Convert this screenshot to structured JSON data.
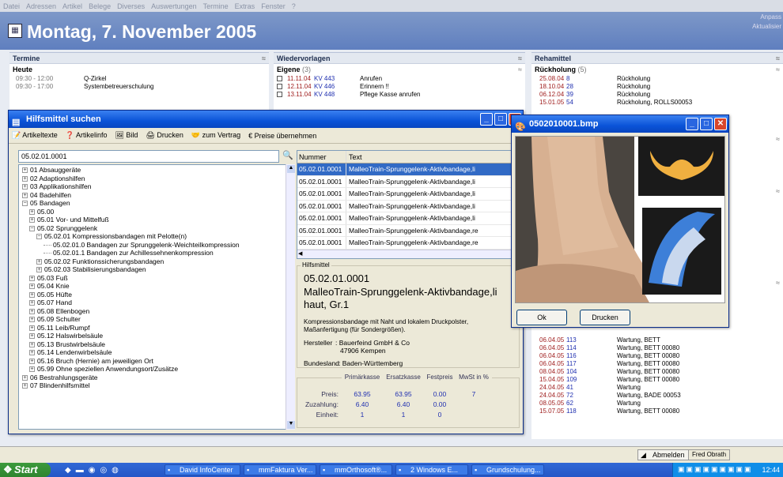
{
  "menu": [
    "Datei",
    "Adressen",
    "Artikel",
    "Belege",
    "Diverses",
    "Auswertungen",
    "Termine",
    "Extras",
    "Fenster",
    "?"
  ],
  "header": {
    "title": "Montag, 7. November 2005",
    "right1": "Anpass",
    "right2": "Aktualisier"
  },
  "termine": {
    "title": "Termine",
    "sub": "Heute",
    "rows": [
      {
        "time": "09:30 - 12:00",
        "text": "Q-Zirkel"
      },
      {
        "time": "09:30 - 17:00",
        "text": "Systembetreuerschulung"
      }
    ]
  },
  "wiedervorlagen": {
    "title": "Wiedervorlagen",
    "sub": "Eigene",
    "count": "(3)",
    "rows": [
      {
        "date": "11.11.04",
        "kv": "KV 443",
        "text": "Anrufen"
      },
      {
        "date": "12.11.04",
        "kv": "KV 446",
        "text": "Erinnern !!"
      },
      {
        "date": "13.11.04",
        "kv": "KV 448",
        "text": "Pflege Kasse anrufen"
      }
    ]
  },
  "rehamittel": {
    "title": "Rehamittel",
    "sub": "Rückholung",
    "count": "(5)",
    "top_rows": [
      {
        "date": "25.08.04",
        "nr": "8",
        "text": "Rückholung"
      },
      {
        "date": "18.10.04",
        "nr": "28",
        "text": "Rückholung"
      },
      {
        "date": "06.12.04",
        "nr": "39",
        "text": "Rückholung"
      },
      {
        "date": "15.01.05",
        "nr": "54",
        "text": "Rückholung, ROLLS00053"
      }
    ],
    "rows": [
      {
        "date": "06.04.05",
        "nr": "113",
        "text": "Wartung, BETT"
      },
      {
        "date": "06.04.05",
        "nr": "114",
        "text": "Wartung, BETT 00080"
      },
      {
        "date": "06.04.05",
        "nr": "116",
        "text": "Wartung, BETT 00080"
      },
      {
        "date": "06.04.05",
        "nr": "117",
        "text": "Wartung, BETT 00080"
      },
      {
        "date": "08.04.05",
        "nr": "104",
        "text": "Wartung, BETT 00080"
      },
      {
        "date": "15.04.05",
        "nr": "109",
        "text": "Wartung, BETT 00080"
      },
      {
        "date": "24.04.05",
        "nr": "41",
        "text": "Wartung"
      },
      {
        "date": "24.04.05",
        "nr": "72",
        "text": "Wartung, BADE 00053"
      },
      {
        "date": "08.05.05",
        "nr": "62",
        "text": "Wartung"
      },
      {
        "date": "15.07.05",
        "nr": "118",
        "text": "Wartung, BETT 00080"
      }
    ]
  },
  "hilfsmittel": {
    "title": "Hilfsmittel suchen",
    "toolbar": [
      "Artikeltexte",
      "Artikelinfo",
      "Bild",
      "Drucken",
      "zum Vertrag",
      "Preise übernehmen"
    ],
    "search_value": "05.02.01.0001",
    "tree": [
      {
        "indent": 0,
        "pm": "+",
        "text": "01  Absauggeräte"
      },
      {
        "indent": 0,
        "pm": "+",
        "text": "02  Adaptionshilfen"
      },
      {
        "indent": 0,
        "pm": "+",
        "text": "03  Applikationshilfen"
      },
      {
        "indent": 0,
        "pm": "+",
        "text": "04  Badehilfen"
      },
      {
        "indent": 0,
        "pm": "−",
        "text": "05  Bandagen"
      },
      {
        "indent": 1,
        "pm": "+",
        "text": "05.00"
      },
      {
        "indent": 1,
        "pm": "+",
        "text": "05.01   Vor- und Mittelfuß"
      },
      {
        "indent": 1,
        "pm": "−",
        "text": "05.02   Sprunggelenk"
      },
      {
        "indent": 2,
        "pm": "−",
        "text": "05.02.01   Kompressionsbandagen mit Pelotte(n)"
      },
      {
        "indent": 3,
        "pm": "",
        "text": "05.02.01.0   Bandagen zur Sprunggelenk-Weichteilkompression"
      },
      {
        "indent": 3,
        "pm": "",
        "text": "05.02.01.1   Bandagen zur Achillessehnenkompression"
      },
      {
        "indent": 2,
        "pm": "+",
        "text": "05.02.02   Funktionssicherungsbandagen"
      },
      {
        "indent": 2,
        "pm": "+",
        "text": "05.02.03   Stabilisierungsbandagen"
      },
      {
        "indent": 1,
        "pm": "+",
        "text": "05.03   Fuß"
      },
      {
        "indent": 1,
        "pm": "+",
        "text": "05.04   Knie"
      },
      {
        "indent": 1,
        "pm": "+",
        "text": "05.05   Hüfte"
      },
      {
        "indent": 1,
        "pm": "+",
        "text": "05.07   Hand"
      },
      {
        "indent": 1,
        "pm": "+",
        "text": "05.08   Ellenbogen"
      },
      {
        "indent": 1,
        "pm": "+",
        "text": "05.09   Schulter"
      },
      {
        "indent": 1,
        "pm": "+",
        "text": "05.11   Leib/Rumpf"
      },
      {
        "indent": 1,
        "pm": "+",
        "text": "05.12   Halswirbelsäule"
      },
      {
        "indent": 1,
        "pm": "+",
        "text": "05.13   Brustwirbelsäule"
      },
      {
        "indent": 1,
        "pm": "+",
        "text": "05.14   Lendenwirbelsäule"
      },
      {
        "indent": 1,
        "pm": "+",
        "text": "05.16   Bruch (Hernie) am jeweiligen Ort"
      },
      {
        "indent": 1,
        "pm": "+",
        "text": "05.99   Ohne speziellen Anwendungsort/Zusätze"
      },
      {
        "indent": 0,
        "pm": "+",
        "text": "06  Bestrahlungsgeräte"
      },
      {
        "indent": 0,
        "pm": "+",
        "text": "07  Blindenhilfsmittel"
      }
    ],
    "grid_headers": [
      "Nummer",
      "Text"
    ],
    "grid_rows": [
      {
        "nr": "05.02.01.0001",
        "text": "MalleoTrain-Sprunggelenk-Aktivbandage,li",
        "sel": true
      },
      {
        "nr": "05.02.01.0001",
        "text": "MalleoTrain-Sprunggelenk-Aktivbandage,li"
      },
      {
        "nr": "05.02.01.0001",
        "text": "MalleoTrain-Sprunggelenk-Aktivbandage,li"
      },
      {
        "nr": "05.02.01.0001",
        "text": "MalleoTrain-Sprunggelenk-Aktivbandage,li"
      },
      {
        "nr": "05.02.01.0001",
        "text": "MalleoTrain-Sprunggelenk-Aktivbandage,li"
      },
      {
        "nr": "05.02.01.0001",
        "text": "MalleoTrain-Sprunggelenk-Aktivbandage,re"
      },
      {
        "nr": "05.02.01.0001",
        "text": "MalleoTrain-Sprunggelenk-Aktivbandage,re"
      },
      {
        "nr": "05.02.01.0001",
        "text": "MalleoTrain-Sprunggelenk-Aktivbandage,re"
      }
    ],
    "detail": {
      "group_label": "Hilfsmittel",
      "number": "05.02.01.0001",
      "name": "MalleoTrain-Sprunggelenk-Aktivbandage,li haut, Gr.1",
      "desc": "Kompressionsbandage mit Naht und lokalem Druckpolster, Maßanfertigung (für Sondergrößen).",
      "hersteller_label": "Hersteller",
      "hersteller1": ": Bauerfeind GmbH & Co",
      "hersteller2": "47906 Kempen",
      "bundesland_label": "Bundesland",
      "bundesland": ": Baden-Württemberg"
    },
    "prices": {
      "headers": [
        "Primärkasse",
        "Ersatzkasse",
        "Festpreis",
        "MwSt in %"
      ],
      "rows": [
        {
          "label": "Preis:",
          "values": [
            "63.95",
            "63.95",
            "0.00",
            "7"
          ]
        },
        {
          "label": "Zuzahlung:",
          "values": [
            "6.40",
            "6.40",
            "0.00",
            ""
          ]
        },
        {
          "label": "Einheit:",
          "values": [
            "1",
            "1",
            "0",
            ""
          ]
        }
      ]
    }
  },
  "image_window": {
    "title": "0502010001.bmp",
    "ok": "Ok",
    "print": "Drucken"
  },
  "statusbar": {
    "abmelden": "Abmelden",
    "user": "Fred Obrath"
  },
  "taskbar": {
    "start": "Start",
    "tasks": [
      "David InfoCenter",
      "mmFaktura Ver...",
      "mmOrthosoft®...",
      "2 Windows E...",
      "Grundschulung..."
    ],
    "clock": "12:44"
  },
  "colors": {
    "title_blue": "#0a53d8",
    "header_blue": "#6f8cc6",
    "selection": "#316ac5",
    "date_red": "#a02020"
  }
}
